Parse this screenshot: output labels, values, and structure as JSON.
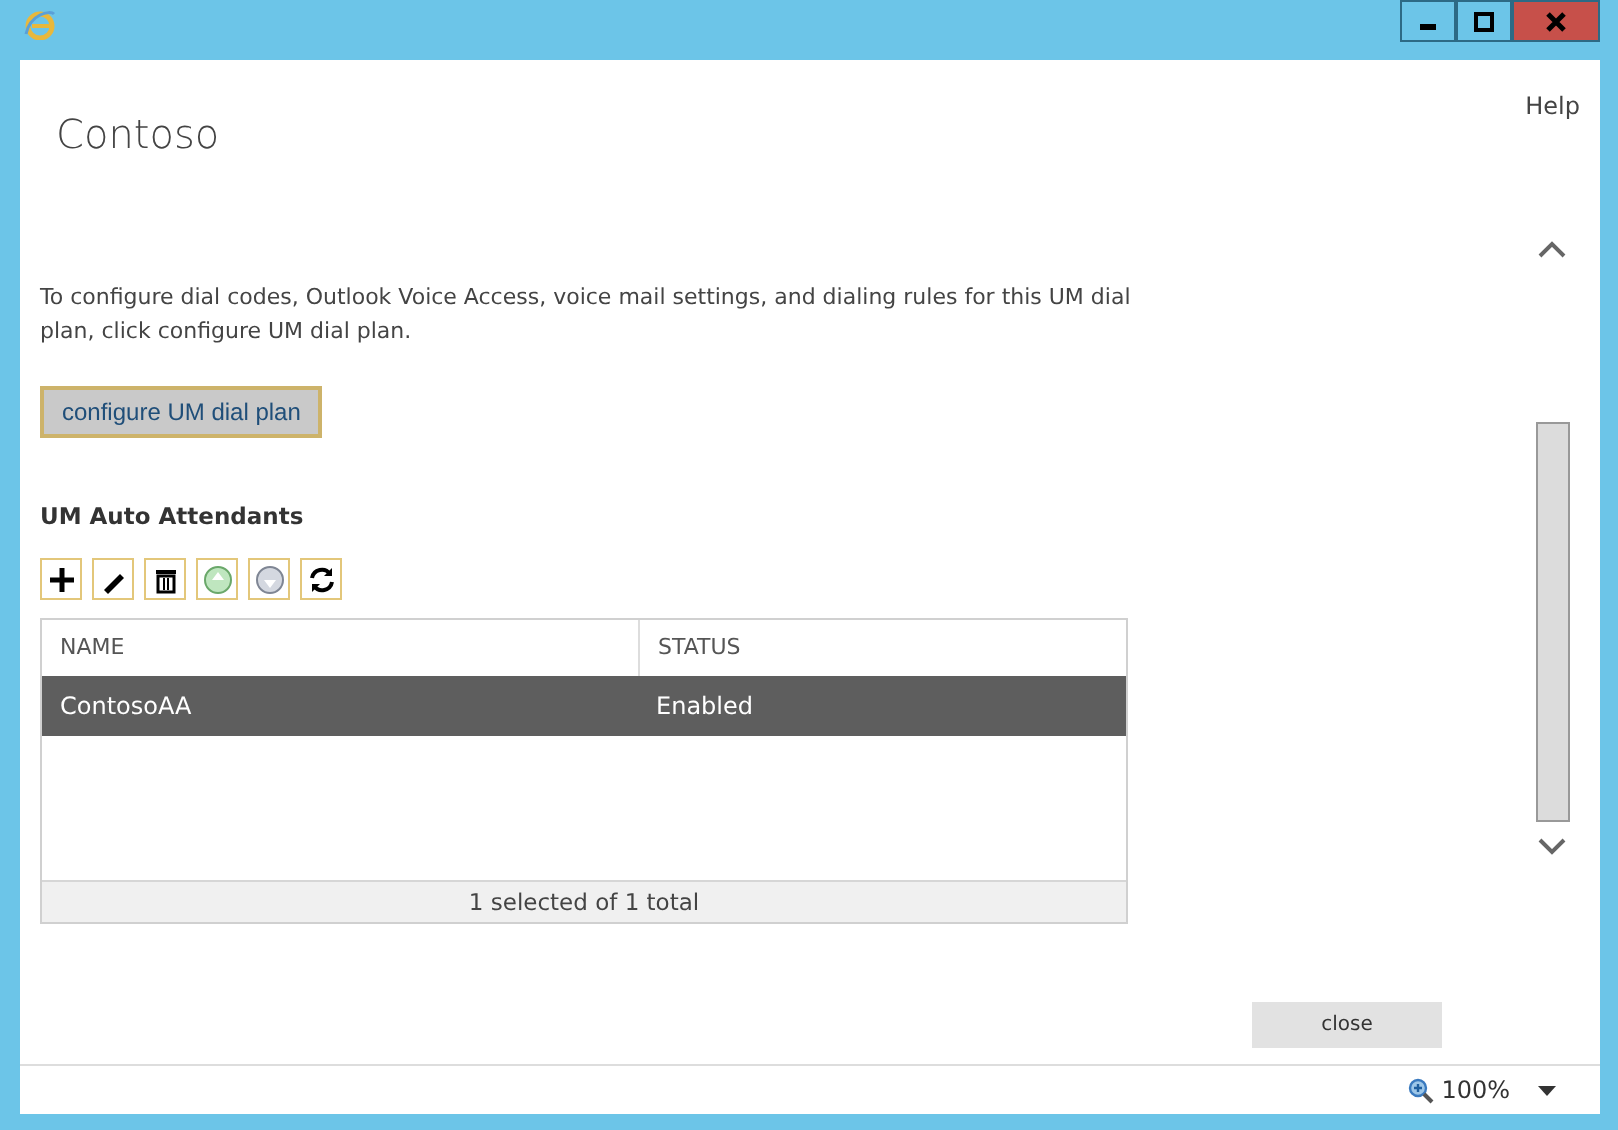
{
  "header": {
    "title": "Contoso",
    "help": "Help"
  },
  "description": "To configure dial codes, Outlook Voice Access, voice mail settings, and dialing rules for this UM dial plan, click configure UM dial plan.",
  "configure_button": "configure UM dial plan",
  "section_title": "UM Auto Attendants",
  "toolbar": [
    {
      "kind": "add"
    },
    {
      "kind": "edit"
    },
    {
      "kind": "delete"
    },
    {
      "kind": "enable"
    },
    {
      "kind": "disable"
    },
    {
      "kind": "refresh"
    }
  ],
  "table": {
    "columns": [
      "NAME",
      "STATUS"
    ],
    "rows": [
      {
        "name": "ContosoAA",
        "status": "Enabled",
        "selected": true
      }
    ],
    "footer": "1 selected of 1 total"
  },
  "close_button": "close",
  "status_bar": {
    "zoom": "100%"
  }
}
